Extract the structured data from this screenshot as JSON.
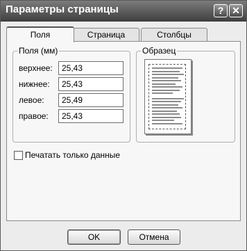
{
  "window": {
    "title": "Параметры страницы",
    "help_label": "?",
    "close_label": "✕"
  },
  "tabs": [
    {
      "label": "Поля"
    },
    {
      "label": "Страница"
    },
    {
      "label": "Столбцы"
    }
  ],
  "margins": {
    "group_label": "Поля (мм)",
    "top_label": "верхнее:",
    "top_value": "25,43",
    "bottom_label": "нижнее:",
    "bottom_value": "25,43",
    "left_label": "левое:",
    "left_value": "25,49",
    "right_label": "правое:",
    "right_value": "25,43"
  },
  "preview": {
    "group_label": "Образец"
  },
  "print_data_only": {
    "label": "Печатать только данные",
    "checked": false
  },
  "buttons": {
    "ok": "OK",
    "cancel": "Отмена"
  }
}
